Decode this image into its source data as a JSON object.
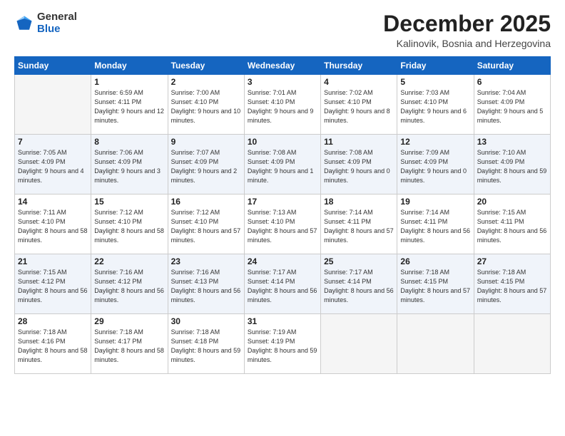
{
  "logo": {
    "general": "General",
    "blue": "Blue"
  },
  "header": {
    "title": "December 2025",
    "subtitle": "Kalinovik, Bosnia and Herzegovina"
  },
  "weekdays": [
    "Sunday",
    "Monday",
    "Tuesday",
    "Wednesday",
    "Thursday",
    "Friday",
    "Saturday"
  ],
  "weeks": [
    [
      {
        "day": "",
        "sunrise": "",
        "sunset": "",
        "daylight": "",
        "empty": true
      },
      {
        "day": "1",
        "sunrise": "Sunrise: 6:59 AM",
        "sunset": "Sunset: 4:11 PM",
        "daylight": "Daylight: 9 hours and 12 minutes."
      },
      {
        "day": "2",
        "sunrise": "Sunrise: 7:00 AM",
        "sunset": "Sunset: 4:10 PM",
        "daylight": "Daylight: 9 hours and 10 minutes."
      },
      {
        "day": "3",
        "sunrise": "Sunrise: 7:01 AM",
        "sunset": "Sunset: 4:10 PM",
        "daylight": "Daylight: 9 hours and 9 minutes."
      },
      {
        "day": "4",
        "sunrise": "Sunrise: 7:02 AM",
        "sunset": "Sunset: 4:10 PM",
        "daylight": "Daylight: 9 hours and 8 minutes."
      },
      {
        "day": "5",
        "sunrise": "Sunrise: 7:03 AM",
        "sunset": "Sunset: 4:10 PM",
        "daylight": "Daylight: 9 hours and 6 minutes."
      },
      {
        "day": "6",
        "sunrise": "Sunrise: 7:04 AM",
        "sunset": "Sunset: 4:09 PM",
        "daylight": "Daylight: 9 hours and 5 minutes."
      }
    ],
    [
      {
        "day": "7",
        "sunrise": "Sunrise: 7:05 AM",
        "sunset": "Sunset: 4:09 PM",
        "daylight": "Daylight: 9 hours and 4 minutes."
      },
      {
        "day": "8",
        "sunrise": "Sunrise: 7:06 AM",
        "sunset": "Sunset: 4:09 PM",
        "daylight": "Daylight: 9 hours and 3 minutes."
      },
      {
        "day": "9",
        "sunrise": "Sunrise: 7:07 AM",
        "sunset": "Sunset: 4:09 PM",
        "daylight": "Daylight: 9 hours and 2 minutes."
      },
      {
        "day": "10",
        "sunrise": "Sunrise: 7:08 AM",
        "sunset": "Sunset: 4:09 PM",
        "daylight": "Daylight: 9 hours and 1 minute."
      },
      {
        "day": "11",
        "sunrise": "Sunrise: 7:08 AM",
        "sunset": "Sunset: 4:09 PM",
        "daylight": "Daylight: 9 hours and 0 minutes."
      },
      {
        "day": "12",
        "sunrise": "Sunrise: 7:09 AM",
        "sunset": "Sunset: 4:09 PM",
        "daylight": "Daylight: 9 hours and 0 minutes."
      },
      {
        "day": "13",
        "sunrise": "Sunrise: 7:10 AM",
        "sunset": "Sunset: 4:09 PM",
        "daylight": "Daylight: 8 hours and 59 minutes."
      }
    ],
    [
      {
        "day": "14",
        "sunrise": "Sunrise: 7:11 AM",
        "sunset": "Sunset: 4:10 PM",
        "daylight": "Daylight: 8 hours and 58 minutes."
      },
      {
        "day": "15",
        "sunrise": "Sunrise: 7:12 AM",
        "sunset": "Sunset: 4:10 PM",
        "daylight": "Daylight: 8 hours and 58 minutes."
      },
      {
        "day": "16",
        "sunrise": "Sunrise: 7:12 AM",
        "sunset": "Sunset: 4:10 PM",
        "daylight": "Daylight: 8 hours and 57 minutes."
      },
      {
        "day": "17",
        "sunrise": "Sunrise: 7:13 AM",
        "sunset": "Sunset: 4:10 PM",
        "daylight": "Daylight: 8 hours and 57 minutes."
      },
      {
        "day": "18",
        "sunrise": "Sunrise: 7:14 AM",
        "sunset": "Sunset: 4:11 PM",
        "daylight": "Daylight: 8 hours and 57 minutes."
      },
      {
        "day": "19",
        "sunrise": "Sunrise: 7:14 AM",
        "sunset": "Sunset: 4:11 PM",
        "daylight": "Daylight: 8 hours and 56 minutes."
      },
      {
        "day": "20",
        "sunrise": "Sunrise: 7:15 AM",
        "sunset": "Sunset: 4:11 PM",
        "daylight": "Daylight: 8 hours and 56 minutes."
      }
    ],
    [
      {
        "day": "21",
        "sunrise": "Sunrise: 7:15 AM",
        "sunset": "Sunset: 4:12 PM",
        "daylight": "Daylight: 8 hours and 56 minutes."
      },
      {
        "day": "22",
        "sunrise": "Sunrise: 7:16 AM",
        "sunset": "Sunset: 4:12 PM",
        "daylight": "Daylight: 8 hours and 56 minutes."
      },
      {
        "day": "23",
        "sunrise": "Sunrise: 7:16 AM",
        "sunset": "Sunset: 4:13 PM",
        "daylight": "Daylight: 8 hours and 56 minutes."
      },
      {
        "day": "24",
        "sunrise": "Sunrise: 7:17 AM",
        "sunset": "Sunset: 4:14 PM",
        "daylight": "Daylight: 8 hours and 56 minutes."
      },
      {
        "day": "25",
        "sunrise": "Sunrise: 7:17 AM",
        "sunset": "Sunset: 4:14 PM",
        "daylight": "Daylight: 8 hours and 56 minutes."
      },
      {
        "day": "26",
        "sunrise": "Sunrise: 7:18 AM",
        "sunset": "Sunset: 4:15 PM",
        "daylight": "Daylight: 8 hours and 57 minutes."
      },
      {
        "day": "27",
        "sunrise": "Sunrise: 7:18 AM",
        "sunset": "Sunset: 4:15 PM",
        "daylight": "Daylight: 8 hours and 57 minutes."
      }
    ],
    [
      {
        "day": "28",
        "sunrise": "Sunrise: 7:18 AM",
        "sunset": "Sunset: 4:16 PM",
        "daylight": "Daylight: 8 hours and 58 minutes."
      },
      {
        "day": "29",
        "sunrise": "Sunrise: 7:18 AM",
        "sunset": "Sunset: 4:17 PM",
        "daylight": "Daylight: 8 hours and 58 minutes."
      },
      {
        "day": "30",
        "sunrise": "Sunrise: 7:18 AM",
        "sunset": "Sunset: 4:18 PM",
        "daylight": "Daylight: 8 hours and 59 minutes."
      },
      {
        "day": "31",
        "sunrise": "Sunrise: 7:19 AM",
        "sunset": "Sunset: 4:19 PM",
        "daylight": "Daylight: 8 hours and 59 minutes."
      },
      {
        "day": "",
        "sunrise": "",
        "sunset": "",
        "daylight": "",
        "empty": true
      },
      {
        "day": "",
        "sunrise": "",
        "sunset": "",
        "daylight": "",
        "empty": true
      },
      {
        "day": "",
        "sunrise": "",
        "sunset": "",
        "daylight": "",
        "empty": true
      }
    ]
  ]
}
